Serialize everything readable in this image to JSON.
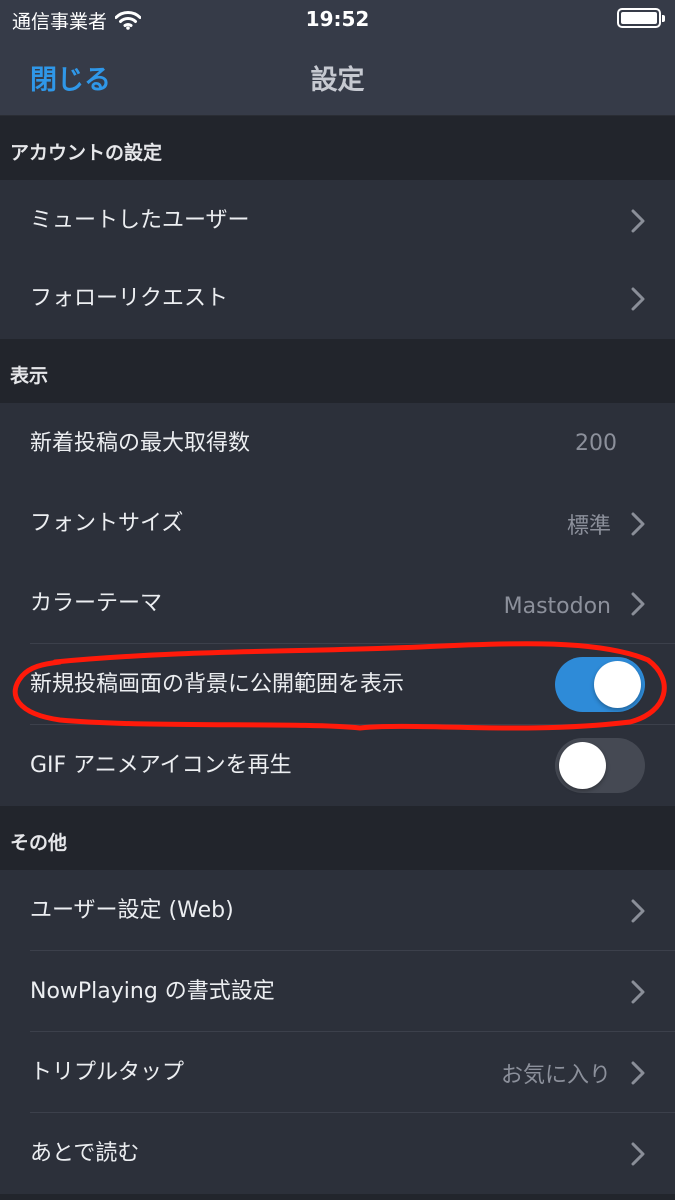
{
  "status_bar": {
    "carrier": "通信事業者",
    "time": "19:52"
  },
  "nav": {
    "close_label": "閉じる",
    "title": "設定"
  },
  "sections": {
    "account": {
      "header": "アカウントの設定",
      "items": [
        {
          "label": "ミュートしたユーザー"
        },
        {
          "label": "フォローリクエスト"
        }
      ]
    },
    "display": {
      "header": "表示",
      "items": [
        {
          "label": "新着投稿の最大取得数",
          "value": "200"
        },
        {
          "label": "フォントサイズ",
          "value": "標準"
        },
        {
          "label": "カラーテーマ",
          "value": "Mastodon"
        },
        {
          "label": "新規投稿画面の背景に公開範囲を表示",
          "toggle": true
        },
        {
          "label": "GIF アニメアイコンを再生",
          "toggle": false
        }
      ]
    },
    "other": {
      "header": "その他",
      "items": [
        {
          "label": "ユーザー設定 (Web)"
        },
        {
          "label": "NowPlaying の書式設定"
        },
        {
          "label": "トリプルタップ",
          "value": "お気に入り"
        },
        {
          "label": "あとで読む"
        }
      ]
    }
  },
  "colors": {
    "accent": "#2f97e8",
    "toggle_on": "#2e8bd8",
    "annotation": "#ff1a0a",
    "background": "#22252c",
    "cell": "#2c303a",
    "bar": "#363b48"
  },
  "icons": {
    "row_disclosure": "chevron-right-icon",
    "wifi": "wifi-icon",
    "battery": "battery-icon"
  }
}
